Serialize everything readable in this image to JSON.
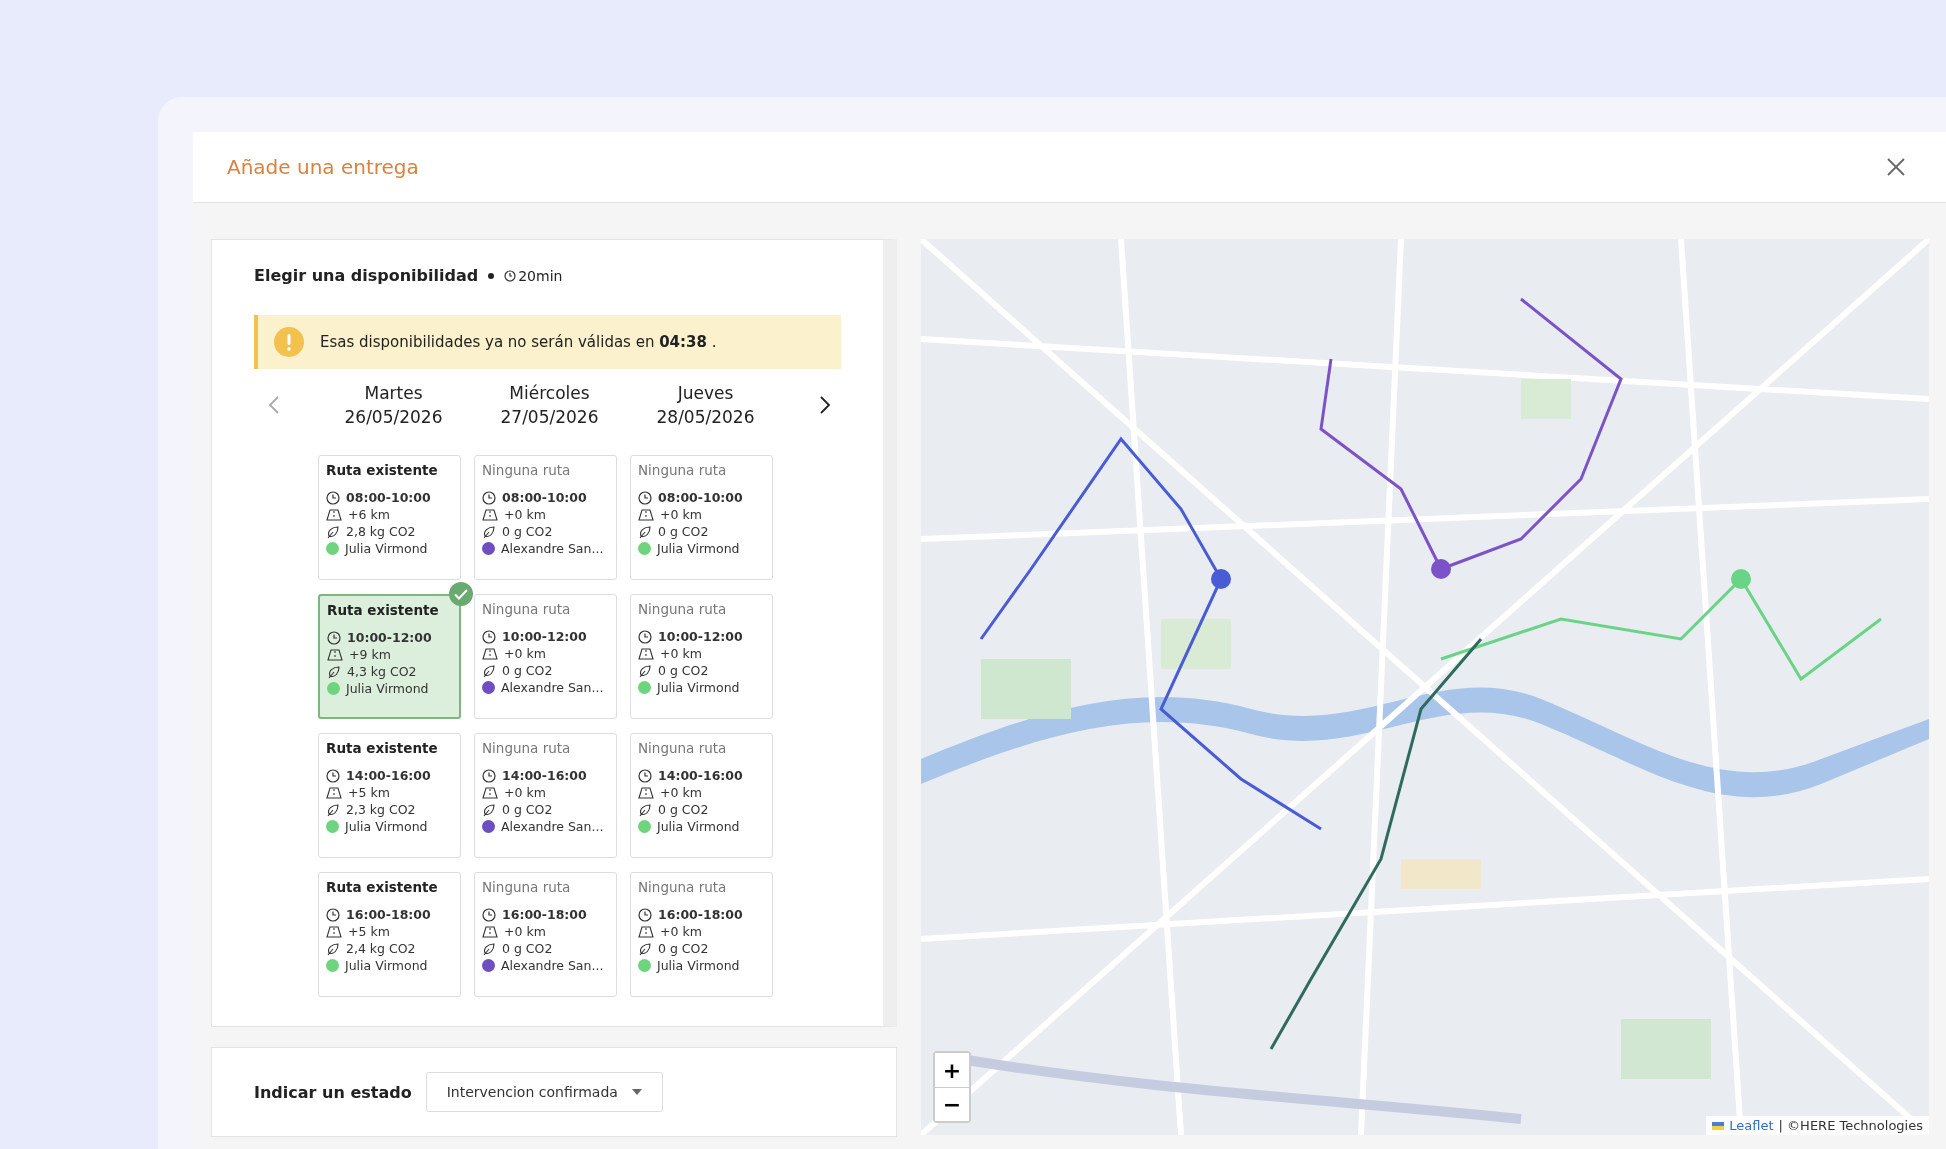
{
  "dialog": {
    "title": "Añade una entrega"
  },
  "availability": {
    "title": "Elegir una disponibilidad",
    "duration": "20min",
    "warning": "Esas disponibilidades ya no serán válidas en **04:38** .",
    "nav": {
      "prev_disabled": true,
      "next_disabled": false
    },
    "days": [
      {
        "name": "Martes",
        "date": "26/05/2026"
      },
      {
        "name": "Miércoles",
        "date": "27/05/2026"
      },
      {
        "name": "Jueves",
        "date": "28/05/2026"
      }
    ],
    "rows": [
      {
        "cards": [
          {
            "kind": "existing",
            "title": "Ruta existente",
            "selected": false,
            "time": "08:00-10:00",
            "distance": "+6 km",
            "co2": "2,8 kg CO2",
            "driver": "Julia Virmond",
            "color": "#6fd47e"
          },
          {
            "kind": "none",
            "title": "Ninguna ruta",
            "selected": false,
            "time": "08:00-10:00",
            "distance": "+0 km",
            "co2": "0 g CO2",
            "driver": "Alexandre San...",
            "color": "#6d4fc2"
          },
          {
            "kind": "none",
            "title": "Ninguna ruta",
            "selected": false,
            "time": "08:00-10:00",
            "distance": "+0 km",
            "co2": "0 g CO2",
            "driver": "Julia Virmond",
            "color": "#6fd47e"
          }
        ]
      },
      {
        "cards": [
          {
            "kind": "existing",
            "title": "Ruta existente",
            "selected": true,
            "time": "10:00-12:00",
            "distance": "+9 km",
            "co2": "4,3 kg CO2",
            "driver": "Julia Virmond",
            "color": "#6fd47e"
          },
          {
            "kind": "none",
            "title": "Ninguna ruta",
            "selected": false,
            "time": "10:00-12:00",
            "distance": "+0 km",
            "co2": "0 g CO2",
            "driver": "Alexandre San...",
            "color": "#6d4fc2"
          },
          {
            "kind": "none",
            "title": "Ninguna ruta",
            "selected": false,
            "time": "10:00-12:00",
            "distance": "+0 km",
            "co2": "0 g CO2",
            "driver": "Julia Virmond",
            "color": "#6fd47e"
          }
        ]
      },
      {
        "cards": [
          {
            "kind": "existing",
            "title": "Ruta existente",
            "selected": false,
            "time": "14:00-16:00",
            "distance": "+5 km",
            "co2": "2,3 kg CO2",
            "driver": "Julia Virmond",
            "color": "#6fd47e"
          },
          {
            "kind": "none",
            "title": "Ninguna ruta",
            "selected": false,
            "time": "14:00-16:00",
            "distance": "+0 km",
            "co2": "0 g CO2",
            "driver": "Alexandre San...",
            "color": "#6d4fc2"
          },
          {
            "kind": "none",
            "title": "Ninguna ruta",
            "selected": false,
            "time": "14:00-16:00",
            "distance": "+0 km",
            "co2": "0 g CO2",
            "driver": "Julia Virmond",
            "color": "#6fd47e"
          }
        ]
      },
      {
        "cards": [
          {
            "kind": "existing",
            "title": "Ruta existente",
            "selected": false,
            "time": "16:00-18:00",
            "distance": "+5 km",
            "co2": "2,4 kg CO2",
            "driver": "Julia Virmond",
            "color": "#6fd47e"
          },
          {
            "kind": "none",
            "title": "Ninguna ruta",
            "selected": false,
            "time": "16:00-18:00",
            "distance": "+0 km",
            "co2": "0 g CO2",
            "driver": "Alexandre San...",
            "color": "#6d4fc2"
          },
          {
            "kind": "none",
            "title": "Ninguna ruta",
            "selected": false,
            "time": "16:00-18:00",
            "distance": "+0 km",
            "co2": "0 g CO2",
            "driver": "Julia Virmond",
            "color": "#6fd47e"
          }
        ]
      }
    ]
  },
  "status": {
    "label": "Indicar un estado",
    "value": "Intervencion confirmada"
  },
  "map": {
    "zoom_in": "+",
    "zoom_out": "−",
    "attribution_link": "Leaflet",
    "attribution": "| ©HERE Technologies"
  }
}
